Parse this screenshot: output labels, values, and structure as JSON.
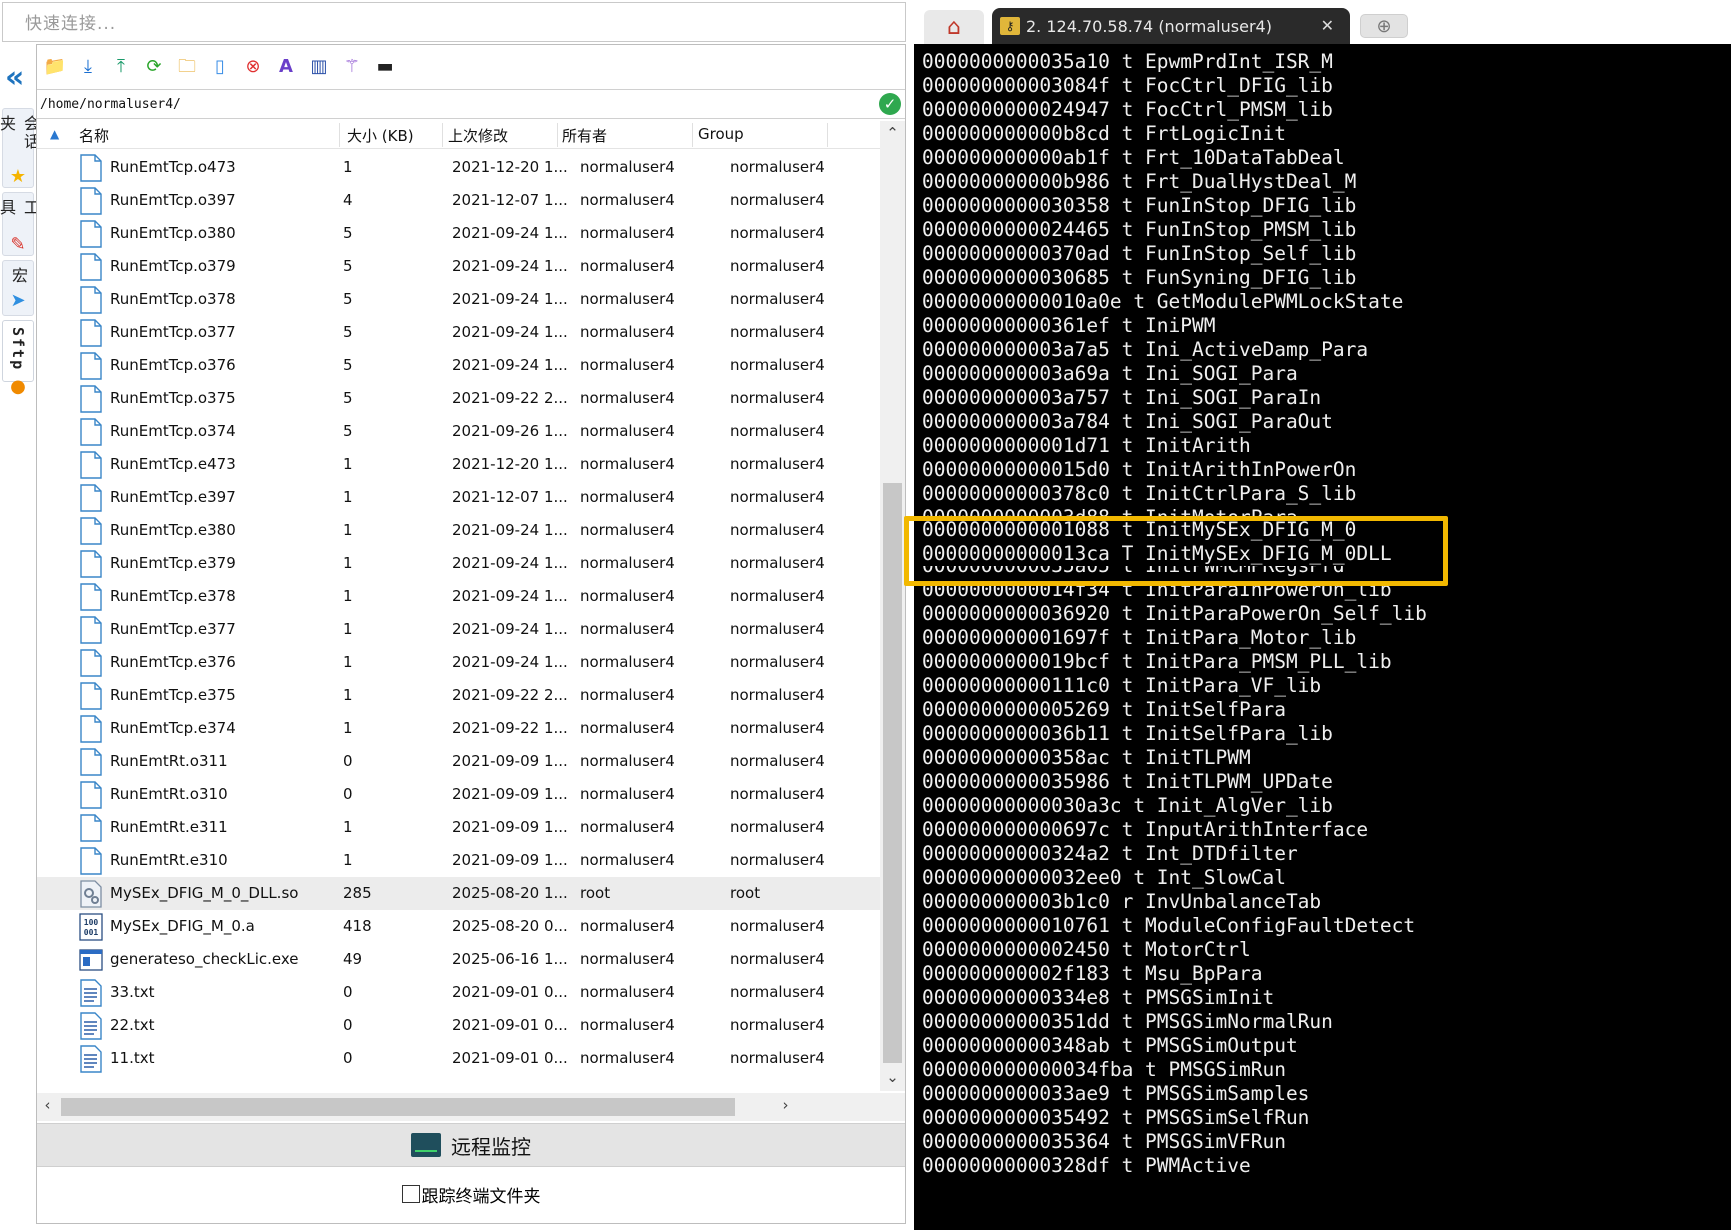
{
  "quick_connect": {
    "placeholder": "快速连接..."
  },
  "side_rail": {
    "tabs": [
      {
        "label": "会话夹",
        "icon": "star-icon"
      },
      {
        "label": "工具",
        "icon": "tools-icon"
      },
      {
        "label": "宏",
        "icon": "send-icon"
      },
      {
        "label": "Sftp",
        "icon": "sftp-icon"
      }
    ]
  },
  "file_panel": {
    "path": "/home/normaluser4/",
    "columns": [
      "名称",
      "大小 (KB)",
      "上次修改",
      "所有者",
      "Group"
    ],
    "files": [
      {
        "name": "RunEmtTcp.o473",
        "size": "1",
        "modified": "2021-12-20 1...",
        "owner": "normaluser4",
        "group": "normaluser4",
        "icon": "file-icon"
      },
      {
        "name": "RunEmtTcp.o397",
        "size": "4",
        "modified": "2021-12-07 1...",
        "owner": "normaluser4",
        "group": "normaluser4",
        "icon": "file-icon"
      },
      {
        "name": "RunEmtTcp.o380",
        "size": "5",
        "modified": "2021-09-24 1...",
        "owner": "normaluser4",
        "group": "normaluser4",
        "icon": "file-icon"
      },
      {
        "name": "RunEmtTcp.o379",
        "size": "5",
        "modified": "2021-09-24 1...",
        "owner": "normaluser4",
        "group": "normaluser4",
        "icon": "file-icon"
      },
      {
        "name": "RunEmtTcp.o378",
        "size": "5",
        "modified": "2021-09-24 1...",
        "owner": "normaluser4",
        "group": "normaluser4",
        "icon": "file-icon"
      },
      {
        "name": "RunEmtTcp.o377",
        "size": "5",
        "modified": "2021-09-24 1...",
        "owner": "normaluser4",
        "group": "normaluser4",
        "icon": "file-icon"
      },
      {
        "name": "RunEmtTcp.o376",
        "size": "5",
        "modified": "2021-09-24 1...",
        "owner": "normaluser4",
        "group": "normaluser4",
        "icon": "file-icon"
      },
      {
        "name": "RunEmtTcp.o375",
        "size": "5",
        "modified": "2021-09-22 2...",
        "owner": "normaluser4",
        "group": "normaluser4",
        "icon": "file-icon"
      },
      {
        "name": "RunEmtTcp.o374",
        "size": "5",
        "modified": "2021-09-26 1...",
        "owner": "normaluser4",
        "group": "normaluser4",
        "icon": "file-icon"
      },
      {
        "name": "RunEmtTcp.e473",
        "size": "1",
        "modified": "2021-12-20 1...",
        "owner": "normaluser4",
        "group": "normaluser4",
        "icon": "file-icon"
      },
      {
        "name": "RunEmtTcp.e397",
        "size": "1",
        "modified": "2021-12-07 1...",
        "owner": "normaluser4",
        "group": "normaluser4",
        "icon": "file-icon"
      },
      {
        "name": "RunEmtTcp.e380",
        "size": "1",
        "modified": "2021-09-24 1...",
        "owner": "normaluser4",
        "group": "normaluser4",
        "icon": "file-icon"
      },
      {
        "name": "RunEmtTcp.e379",
        "size": "1",
        "modified": "2021-09-24 1...",
        "owner": "normaluser4",
        "group": "normaluser4",
        "icon": "file-icon"
      },
      {
        "name": "RunEmtTcp.e378",
        "size": "1",
        "modified": "2021-09-24 1...",
        "owner": "normaluser4",
        "group": "normaluser4",
        "icon": "file-icon"
      },
      {
        "name": "RunEmtTcp.e377",
        "size": "1",
        "modified": "2021-09-24 1...",
        "owner": "normaluser4",
        "group": "normaluser4",
        "icon": "file-icon"
      },
      {
        "name": "RunEmtTcp.e376",
        "size": "1",
        "modified": "2021-09-24 1...",
        "owner": "normaluser4",
        "group": "normaluser4",
        "icon": "file-icon"
      },
      {
        "name": "RunEmtTcp.e375",
        "size": "1",
        "modified": "2021-09-22 2...",
        "owner": "normaluser4",
        "group": "normaluser4",
        "icon": "file-icon"
      },
      {
        "name": "RunEmtTcp.e374",
        "size": "1",
        "modified": "2021-09-22 1...",
        "owner": "normaluser4",
        "group": "normaluser4",
        "icon": "file-icon"
      },
      {
        "name": "RunEmtRt.o311",
        "size": "0",
        "modified": "2021-09-09 1...",
        "owner": "normaluser4",
        "group": "normaluser4",
        "icon": "file-icon"
      },
      {
        "name": "RunEmtRt.o310",
        "size": "0",
        "modified": "2021-09-09 1...",
        "owner": "normaluser4",
        "group": "normaluser4",
        "icon": "file-icon"
      },
      {
        "name": "RunEmtRt.e311",
        "size": "1",
        "modified": "2021-09-09 1...",
        "owner": "normaluser4",
        "group": "normaluser4",
        "icon": "file-icon"
      },
      {
        "name": "RunEmtRt.e310",
        "size": "1",
        "modified": "2021-09-09 1...",
        "owner": "normaluser4",
        "group": "normaluser4",
        "icon": "file-icon"
      },
      {
        "name": "MySEx_DFIG_M_0_DLL.so",
        "size": "285",
        "modified": "2025-08-20 1...",
        "owner": "root",
        "group": "root",
        "icon": "gear-file-icon",
        "selected": true
      },
      {
        "name": "MySEx_DFIG_M_0.a",
        "size": "418",
        "modified": "2025-08-20 0...",
        "owner": "normaluser4",
        "group": "normaluser4",
        "icon": "binary-file-icon"
      },
      {
        "name": "generateso_checkLic.exe",
        "size": "49",
        "modified": "2025-06-16 1...",
        "owner": "normaluser4",
        "group": "normaluser4",
        "icon": "exe-file-icon"
      },
      {
        "name": "33.txt",
        "size": "0",
        "modified": "2021-09-01 0...",
        "owner": "normaluser4",
        "group": "normaluser4",
        "icon": "text-file-icon"
      },
      {
        "name": "22.txt",
        "size": "0",
        "modified": "2021-09-01 0...",
        "owner": "normaluser4",
        "group": "normaluser4",
        "icon": "text-file-icon"
      },
      {
        "name": "11.txt",
        "size": "0",
        "modified": "2021-09-01 0...",
        "owner": "normaluser4",
        "group": "normaluser4",
        "icon": "text-file-icon"
      }
    ],
    "monitor_label": "远程监控",
    "track_label": "跟踪终端文件夹"
  },
  "tabs": {
    "session_title": "2. 124.70.58.74 (normaluser4)"
  },
  "terminal": {
    "lines": [
      "0000000000035a10 t EpwmPrdInt_ISR_M",
      "000000000003084f t FocCtrl_DFIG_lib",
      "0000000000024947 t FocCtrl_PMSM_lib",
      "000000000000b8cd t FrtLogicInit",
      "000000000000ab1f t Frt_10DataTabDeal",
      "000000000000b986 t Frt_DualHystDeal_M",
      "0000000000030358 t FunInStop_DFIG_lib",
      "0000000000024465 t FunInStop_PMSM_lib",
      "00000000000370ad t FunInStop_Self_lib",
      "0000000000030685 t FunSyning_DFIG_lib",
      "00000000000010a0e t GetModulePWMLockState",
      "00000000000361ef t IniPWM",
      "000000000003a7a5 t Ini_ActiveDamp_Para",
      "000000000003a69a t Ini_SOGI_Para",
      "000000000003a757 t Ini_SOGI_ParaIn",
      "000000000003a784 t Ini_SOGI_ParaOut",
      "0000000000001d71 t InitArith",
      "00000000000015d0 t InitArithInPowerOn",
      "00000000000378c0 t InitCtrlPara_S_lib",
      "0000000000003d88 t InitMotorPara",
      "0000000000001088 t InitMySEx_DFIG_M_0",
      "00000000000013ca T InitMySEx_DFIG_M_0DLL",
      "0000000000035a05 t InitPWMCMPRegsPrd",
      "0000000000014f34 t InitParaInPowerOn_lib",
      "0000000000036920 t InitParaPowerOn_Self_lib",
      "000000000001697f t InitPara_Motor_lib",
      "0000000000019bcf t InitPara_PMSM_PLL_lib",
      "00000000000111c0 t InitPara_VF_lib",
      "0000000000005269 t InitSelfPara",
      "0000000000036b11 t InitSelfPara_lib",
      "00000000000358ac t InitTLPWM",
      "0000000000035986 t InitTLPWM_UPDate",
      "00000000000030a3c t Init_AlgVer_lib",
      "000000000000697c t InputArithInterface",
      "00000000000324a2 t Int_DTDfilter",
      "00000000000032ee0 t Int_SlowCal",
      "000000000003b1c0 r InvUnbalanceTab",
      "0000000000010761 t ModuleConfigFaultDetect",
      "0000000000002450 t MotorCtrl",
      "000000000002f183 t Msu_BpPara",
      "00000000000334e8 t PMSGSimInit",
      "00000000000351dd t PMSGSimNormalRun",
      "00000000000348ab t PMSGSimOutput",
      "000000000000034fba t PMSGSimRun",
      "0000000000033ae9 t PMSGSimSamples",
      "0000000000035492 t PMSGSimSelfRun",
      "0000000000035364 t PMSGSimVFRun",
      "00000000000328df t PWMActive"
    ]
  }
}
